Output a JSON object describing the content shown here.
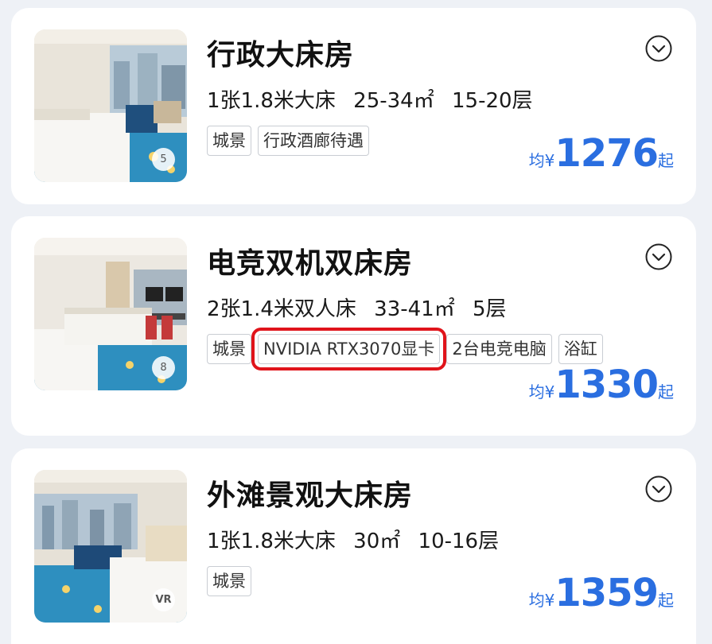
{
  "rooms": [
    {
      "title": "行政大床房",
      "bed": "1张1.8米大床",
      "area": "25-34㎡",
      "floor": "15-20层",
      "tags": [
        "城景",
        "行政酒廊待遇"
      ],
      "photo_count": "5",
      "price_prefix": "均¥",
      "price": "1276",
      "price_suffix": "起"
    },
    {
      "title": "电竞双机双床房",
      "bed": "2张1.4米双人床",
      "area": "33-41㎡",
      "floor": "5层",
      "tags": [
        "城景",
        "NVIDIA RTX3070显卡",
        "2台电竞电脑",
        "浴缸"
      ],
      "highlighted_tag": "NVIDIA RTX3070显卡",
      "photo_count": "8",
      "price_prefix": "均¥",
      "price": "1330",
      "price_suffix": "起"
    },
    {
      "title": "外滩景观大床房",
      "bed": "1张1.8米大床",
      "area": "30㎡",
      "floor": "10-16层",
      "tags": [
        "城景"
      ],
      "photo_count": "VR",
      "price_prefix": "均¥",
      "price": "1359",
      "price_suffix": "起"
    }
  ],
  "colors": {
    "price": "#2a6ee0",
    "highlight": "#e0141b",
    "carpet": "#2e8fbf",
    "background": "#eef1f6"
  },
  "icons": {
    "expand": "chevron-down-circle-icon"
  }
}
